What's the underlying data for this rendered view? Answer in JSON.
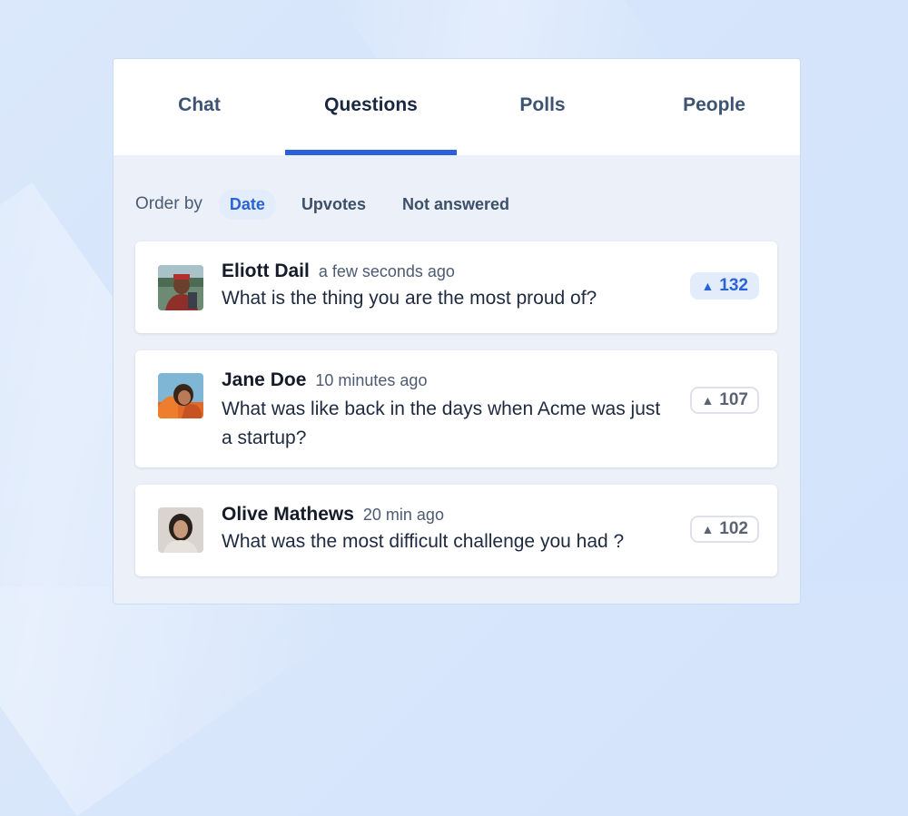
{
  "tabs": [
    "Chat",
    "Questions",
    "Polls",
    "People"
  ],
  "order_by": {
    "label": "Order by",
    "options": [
      "Date",
      "Upvotes",
      "Not answered"
    ],
    "selected": "Date"
  },
  "questions": [
    {
      "name": "Eliott Dail",
      "time": "a few seconds ago",
      "text": "What is the thing you are the most proud of?",
      "votes": "132",
      "voted": true
    },
    {
      "name": "Jane Doe",
      "time": "10 minutes ago",
      "text": "What was like back in the days when Acme was just a startup?",
      "votes": "107",
      "voted": false
    },
    {
      "name": "Olive Mathews",
      "time": "20 min ago",
      "text": "What was the most difficult challenge you had ?",
      "votes": "102",
      "voted": false
    }
  ],
  "icons": {
    "upvote": "triangle-up-icon"
  },
  "colors": {
    "accent": "#2a60d9",
    "accent_bg": "#e3ecfb"
  }
}
